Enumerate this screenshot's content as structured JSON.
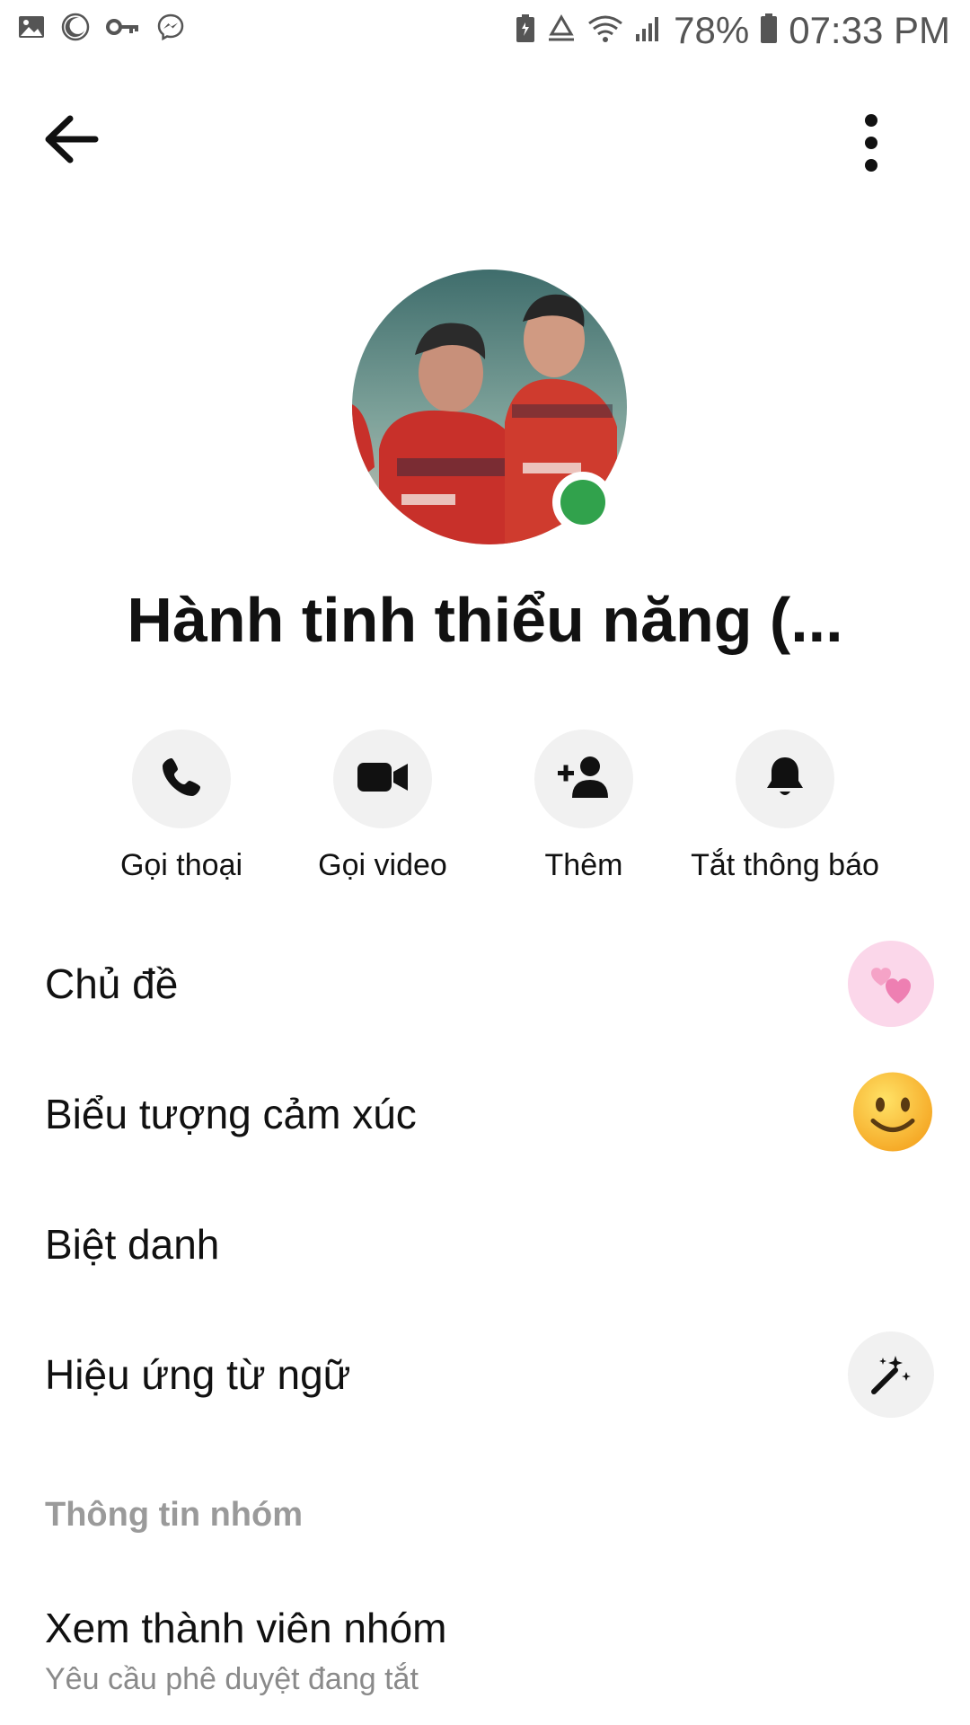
{
  "status_bar": {
    "battery_percent": "78%",
    "time": "07:33 PM",
    "left_icons": [
      "gallery-icon",
      "moon-icon",
      "key-icon",
      "messenger-icon"
    ],
    "right_icons": [
      "battery-saver-icon",
      "recycle-icon",
      "wifi-icon",
      "signal-icon",
      "battery-icon"
    ]
  },
  "header": {
    "back_icon": "arrow-left-icon",
    "more_icon": "more-vertical-icon"
  },
  "group": {
    "name": "Hành tinh thiểu năng (...",
    "online": true,
    "online_color": "#31a24c"
  },
  "actions": [
    {
      "label": "Gọi thoại",
      "icon": "phone-icon"
    },
    {
      "label": "Gọi video",
      "icon": "video-camera-icon"
    },
    {
      "label": "Thêm",
      "icon": "add-person-icon"
    },
    {
      "label": "Tắt thông báo",
      "icon": "bell-icon"
    }
  ],
  "settings": [
    {
      "label": "Chủ đề",
      "icon": "hearts-theme-icon"
    },
    {
      "label": "Biểu tượng cảm xúc",
      "icon": "smiley-emoji-icon"
    },
    {
      "label": "Biệt danh"
    },
    {
      "label": "Hiệu ứng từ ngữ",
      "icon": "magic-wand-icon"
    }
  ],
  "group_info": {
    "section_title": "Thông tin nhóm",
    "view_members": "Xem thành viên nhóm",
    "approval_status": "Yêu cầu phê duyệt đang tắt"
  },
  "colors": {
    "theme_pink": "#fbd7ea",
    "section_gray": "#9a9a9a",
    "button_bg": "#f1f1f1"
  }
}
